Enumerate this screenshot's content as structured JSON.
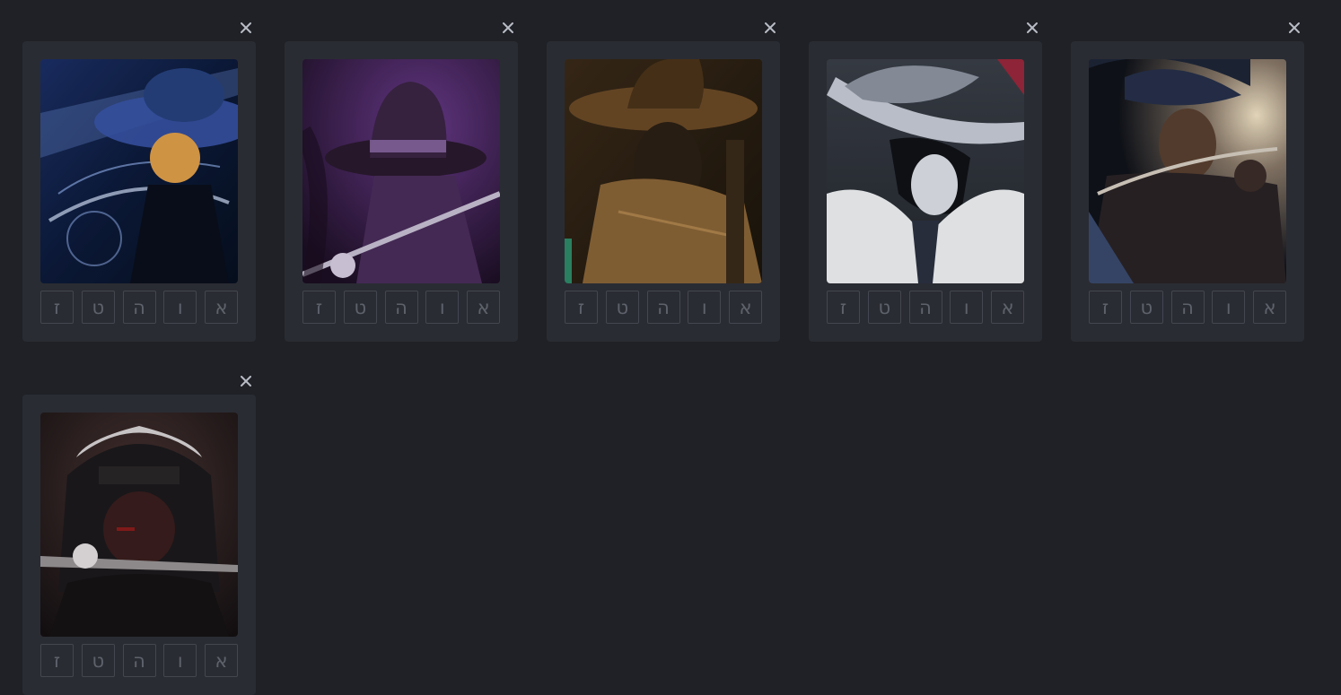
{
  "close_icon": "close-icon",
  "cards": [
    {
      "title": "card-1",
      "palette": [
        "#0c1a3a",
        "#6e8fd8",
        "#d9e6ff",
        "#e1a04a"
      ],
      "letters": [
        "ז",
        "ט",
        "ה",
        "ו",
        "א"
      ]
    },
    {
      "title": "card-2",
      "palette": [
        "#1c0f24",
        "#6a3a8c",
        "#b48ad6",
        "#2a1a2e"
      ],
      "letters": [
        "ז",
        "ט",
        "ה",
        "ו",
        "א"
      ]
    },
    {
      "title": "card-3",
      "palette": [
        "#1a140c",
        "#6b4a26",
        "#c69a5a",
        "#2b2014"
      ],
      "letters": [
        "ז",
        "ט",
        "ה",
        "ו",
        "א"
      ]
    },
    {
      "title": "card-4",
      "palette": [
        "#23272e",
        "#c9ced8",
        "#f1f3f6",
        "#101216"
      ],
      "letters": [
        "ז",
        "ט",
        "ה",
        "ו",
        "א"
      ]
    },
    {
      "title": "card-5",
      "palette": [
        "#10131a",
        "#3a4a6e",
        "#f4e6c8",
        "#2a2326"
      ],
      "letters": [
        "ז",
        "ט",
        "ה",
        "ו",
        "א"
      ]
    },
    {
      "title": "card-6",
      "palette": [
        "#141012",
        "#4a3432",
        "#d8d4d6",
        "#8a1d1d"
      ],
      "letters": [
        "ז",
        "ט",
        "ה",
        "ו",
        "א"
      ]
    }
  ]
}
